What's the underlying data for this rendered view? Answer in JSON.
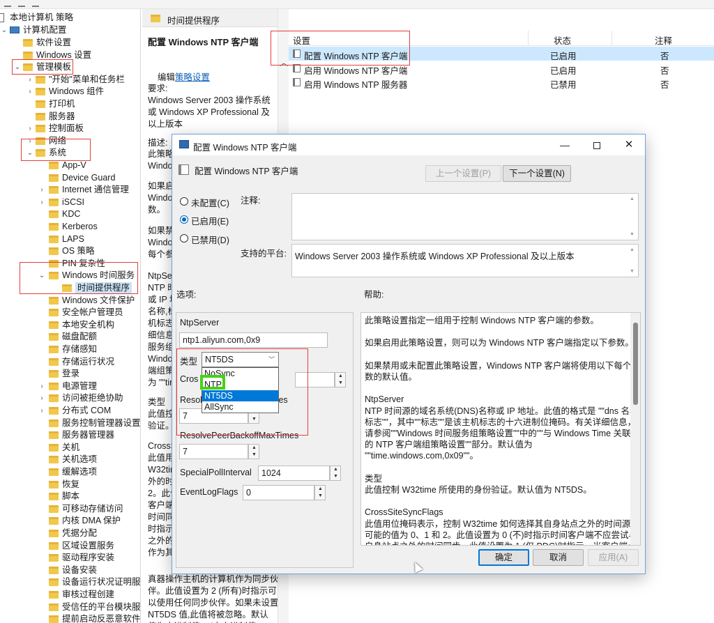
{
  "tree": {
    "root": "本地计算机 策略",
    "computer_config": "计算机配置",
    "items": [
      "软件设置",
      "Windows 设置",
      "管理模板",
      "\"开始\"菜单和任务栏",
      "Windows 组件",
      "打印机",
      "服务器",
      "控制面板",
      "网络",
      "系统",
      "App-V",
      "Device Guard",
      "Internet 通信管理",
      "iSCSI",
      "KDC",
      "Kerberos",
      "LAPS",
      "OS 策略",
      "PIN 复杂性",
      "Windows 时间服务",
      "时间提供程序",
      "Windows 文件保护",
      "安全帐户管理员",
      "本地安全机构",
      "磁盘配额",
      "存储感知",
      "存储运行状况",
      "登录",
      "电源管理",
      "访问被拒绝协助",
      "分布式 COM",
      "服务控制管理器设置",
      "服务器管理器",
      "关机",
      "关机选项",
      "缓解选项",
      "恢复",
      "脚本",
      "可移动存储访问",
      "内核 DMA 保护",
      "凭据分配",
      "区域设置服务",
      "驱动程序安装",
      "设备安装",
      "设备运行状况证明服务",
      "审核过程创建",
      "受信任的平台模块服务",
      "提前启动反恶意软件"
    ]
  },
  "middle": {
    "header": "时间提供程序",
    "title": "配置 Windows NTP 客户端",
    "edit_prefix": "编辑",
    "edit_link": "策略设置",
    "lines": [
      "要求:",
      "Windows Server 2003 操作系统",
      "或 Windows XP Professional 及",
      "以上版本",
      "描述:",
      "此策略",
      "Windo",
      "如果启",
      "Windo",
      "数。",
      "如果禁",
      "Windo",
      "每个参",
      "NtpSe",
      "NTP 时",
      "或 IP 地",
      "名称,标",
      "机标志",
      "细信息",
      "服务组",
      "Windo",
      "端组策",
      "为 \"\"tir",
      "类型",
      "此值控",
      "验证。",
      "CrossS",
      "此值用",
      "W32tim",
      "外的时",
      "2。此位",
      "客户端",
      "时间同",
      "时指示",
      "之外的",
      "作为其",
      "真器操作主机的计算机作为同步伙",
      "伴。此值设置为 2 (所有)时指示可",
      "以使用任何同步伙伴。如果未设置",
      "NT5DS 值,此值将被忽略。默认",
      "值为十进制值 2 (十六进制值"
    ]
  },
  "list": {
    "headers": {
      "setting": "设置",
      "state": "状态",
      "comment": "注释"
    },
    "rows": [
      {
        "name": "配置 Windows NTP 客户端",
        "state": "已启用",
        "comment": "否"
      },
      {
        "name": "启用 Windows NTP 客户端",
        "state": "已启用",
        "comment": "否"
      },
      {
        "name": "启用 Windows NTP 服务器",
        "state": "已禁用",
        "comment": "否"
      }
    ]
  },
  "dialog": {
    "title": "配置 Windows NTP 客户端",
    "setting_name": "配置 Windows NTP 客户端",
    "prev_button": "上一个设置(P)",
    "next_button": "下一个设置(N)",
    "radio_not_configured": "未配置(C)",
    "radio_enabled": "已启用(E)",
    "radio_disabled": "已禁用(D)",
    "comment_label": "注释:",
    "platform_label": "支持的平台:",
    "platform_value": "Windows Server 2003 操作系统或 Windows XP Professional 及以上版本",
    "options_label": "选项:",
    "help_label": "帮助:",
    "options": {
      "ntpserver_label": "NtpServer",
      "ntpserver_value": "ntp1.aliyun.com,0x9",
      "type_label": "类型",
      "type_value": "NT5DS",
      "cross_label": "Cros",
      "resolve_partial": "Resol",
      "resolve_suffix": "tes",
      "resolve_value": "7",
      "backoff_label": "ResolvePeerBackoffMaxTimes",
      "backoff_value": "7",
      "special_label": "SpecialPollInterval",
      "special_value": "1024",
      "eventlog_label": "EventLogFlags",
      "eventlog_value": "0",
      "dropdown_options": [
        "NoSync",
        "NTP",
        "NT5DS",
        "AllSync"
      ],
      "dropdown_highlight": "NT5DS"
    },
    "help_lines": [
      "此策略设置指定一组用于控制 Windows NTP 客户端的参数。",
      "",
      "如果启用此策略设置，则可以为 Windows NTP 客户端指定以下参数。",
      "",
      "如果禁用或未配置此策略设置，Windows NTP 客户端将使用以下每个参",
      "数的默认值。",
      "",
      "NtpServer",
      "NTP 时间源的域名系统(DNS)名称或 IP 地址。此值的格式是 \"\"dns 名称,",
      "标志\"\"，其中\"\"标志\"\"是该主机标志的十六进制位掩码。有关详细信息，",
      "请参阅\"\"Windows 时间服务组策略设置\"\"中的\"\"与 Windows Time 关联",
      "的 NTP 客户端组策略设置\"\"部分。默认值为",
      "\"\"time.windows.com,0x09\"\"。",
      "",
      "类型",
      "此值控制 W32time 所使用的身份验证。默认值为 NT5DS。",
      "",
      "CrossSiteSyncFlags",
      "此值用位掩码表示，控制 W32time 如何选择其自身站点之外的时间源。",
      "可能的值为 0、1 和 2。此值设置为 0 (不)时指示时间客户端不应尝试与",
      "自身站点之外的时间同步。此值设置为 1 (仅 PDC)时指示，当客户端必须"
    ],
    "ok_button": "确定",
    "cancel_button": "取消",
    "apply_button": "应用(A)"
  },
  "colors": {
    "accent": "#0078d7",
    "annotation_red": "#e0403c",
    "annotation_green": "#43d317",
    "folder_yellow": "#f1c84b"
  }
}
